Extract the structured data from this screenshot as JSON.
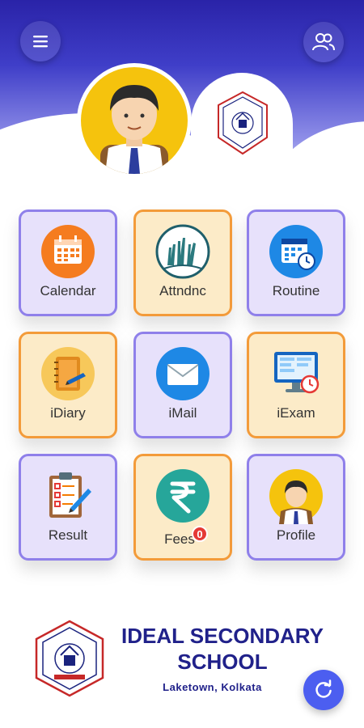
{
  "header": {
    "menu_icon": "menu-icon",
    "users_icon": "users-icon",
    "avatar_image": "student-avatar",
    "logo_image": "school-crest"
  },
  "tiles": [
    {
      "label": "Calendar",
      "icon": "calendar-icon",
      "theme": "purple"
    },
    {
      "label": "Attndnc",
      "icon": "raised-hands-icon",
      "theme": "orange"
    },
    {
      "label": "Routine",
      "icon": "routine-icon",
      "theme": "purple"
    },
    {
      "label": "iDiary",
      "icon": "diary-icon",
      "theme": "orange"
    },
    {
      "label": "iMail",
      "icon": "mail-icon",
      "theme": "purple"
    },
    {
      "label": "iExam",
      "icon": "exam-icon",
      "theme": "orange"
    },
    {
      "label": "Result",
      "icon": "clipboard-icon",
      "theme": "purple"
    },
    {
      "label": "Fees",
      "icon": "rupee-icon",
      "theme": "orange",
      "badge": "0"
    },
    {
      "label": "Profile",
      "icon": "profile-icon",
      "theme": "purple"
    }
  ],
  "footer": {
    "school_line1": "IDEAL SECONDARY",
    "school_line2": "SCHOOL",
    "location": "Laketown, Kolkata"
  },
  "fab": {
    "icon": "refresh-icon"
  },
  "colors": {
    "header_top": "#2a23a8",
    "tile_purple_bg": "#e7e1fb",
    "tile_purple_border": "#8f80ea",
    "tile_orange_bg": "#fcebc8",
    "tile_orange_border": "#f39b3a",
    "brand_text": "#20218a",
    "fab": "#4c5ef0"
  }
}
